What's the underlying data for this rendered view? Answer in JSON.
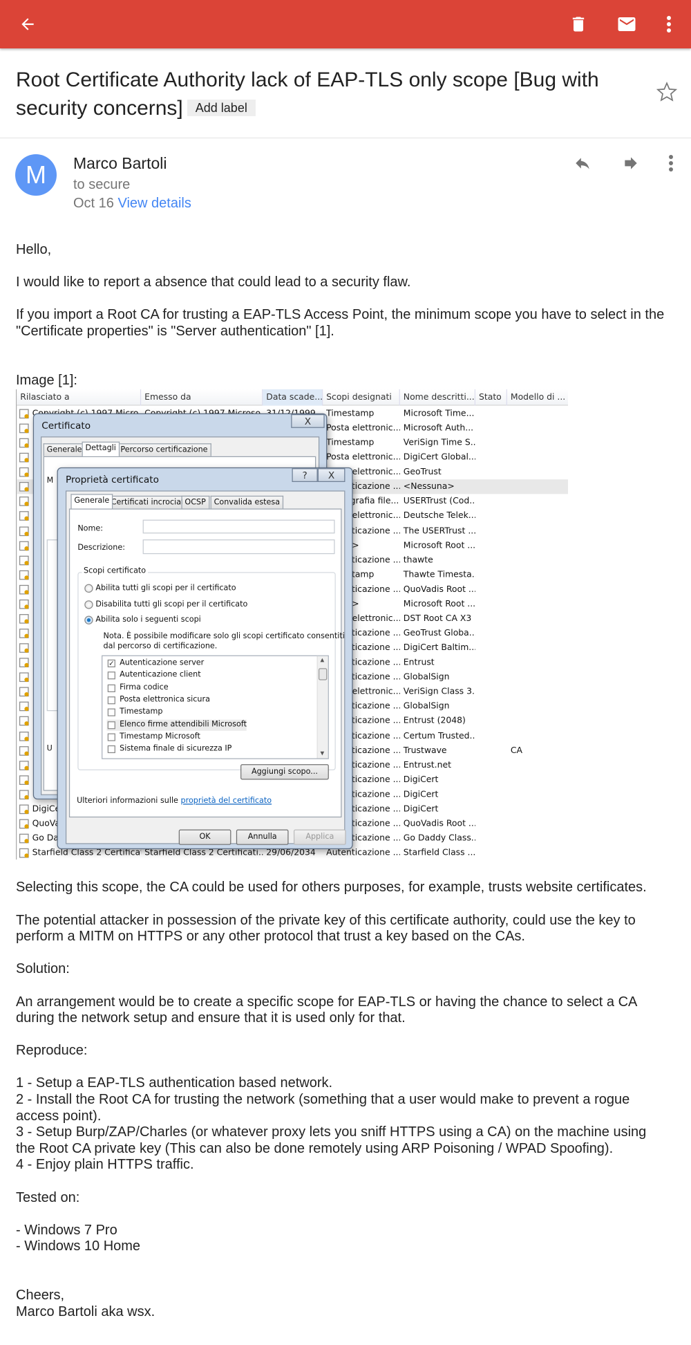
{
  "appbar": {
    "back": "arrow-back",
    "delete": "trash",
    "mark_unread": "mail",
    "more": "more-vert"
  },
  "subject": "Root Certificate Authority lack of EAP-TLS only scope [Bug with security concerns]",
  "subject_lines": [
    "Root Certificate Authority lack of EAP-TLS only scope [Bug with",
    "security concerns]"
  ],
  "add_label": "Add label",
  "sender": {
    "initial": "M",
    "name": "Marco Bartoli",
    "to": "to secure",
    "date": "Oct 16",
    "view_details": "View details"
  },
  "colors": {
    "appbar": "#db4437",
    "avatar": "#5e97f6",
    "link": "#4285f4"
  },
  "body": {
    "hello": "Hello,",
    "p1": "I would like to report a absence that could lead to a security flaw.",
    "p2": [
      "If you import a Root CA for trusting a EAP-TLS Access Point, the minimum scope you have to select in the",
      "\"Certificate properties\" is \"Server authentication\" [1]."
    ],
    "image_caption": "Image [1]:",
    "p3": "Selecting this scope, the CA could be used for others purposes, for example, trusts website certificates.",
    "p4": [
      "The potential attacker in possession of the private key of this certificate authority, could use the key to",
      "perform a MITM on HTTPS or any other protocol that trust a key based on the CAs."
    ],
    "solution": "Solution:",
    "p5": [
      "An arrangement would be to create a specific scope for EAP-TLS or having the chance to select a CA",
      "during the network setup and ensure that it is used only for that."
    ],
    "reproduce": "Reproduce:",
    "steps": [
      "1 - Setup a EAP-TLS authentication based network.",
      "2 - Install the Root CA for trusting the network (something that a user would make to prevent a rogue",
      "access point).",
      "3 - Setup Burp/ZAP/Charles (or whatever proxy lets you sniff HTTPS using a CA) on the machine using",
      "the Root CA private key (This can also be done remotely using ARP Poisoning / WPAD Spoofing).",
      "4 - Enjoy plain HTTPS traffic."
    ],
    "tested": "Tested on:",
    "platforms": [
      "- Windows 7 Pro",
      "- Windows 10 Home"
    ],
    "cheers": "Cheers,",
    "signature": "Marco Bartoli aka wsx."
  },
  "screenshot": {
    "columns": [
      "Rilasciato a",
      "Emesso da",
      "Data scade...",
      "Scopi designati",
      "Nome descritti...",
      "Stato",
      "Modello di ..."
    ],
    "rows": [
      [
        "Copyright (c) 1997 Micro...",
        "Copyright (c) 1997 Microso...",
        "31/12/1999",
        "Timestamp",
        "Microsoft Time...",
        "",
        ""
      ],
      [
        "",
        "",
        "",
        "Posta elettronic...",
        "Microsoft Auth...",
        "",
        ""
      ],
      [
        "",
        "",
        "",
        "Timestamp",
        "VeriSign Time S...",
        "",
        ""
      ],
      [
        "",
        "",
        "",
        "Posta elettronic...",
        "DigiCert Global...",
        "",
        ""
      ],
      [
        "",
        "",
        "",
        "Posta elettronic...",
        "GeoTrust",
        "",
        ""
      ],
      [
        "",
        "",
        "",
        "Autenticazione ...",
        "<Nessuna>",
        "",
        ""
      ],
      [
        "",
        "",
        "",
        "Crittografia file...",
        "USERTrust (Cod...",
        "",
        ""
      ],
      [
        "",
        "",
        "",
        "Posta elettronic...",
        "Deutsche Telek...",
        "",
        ""
      ],
      [
        "",
        "",
        "",
        "Autenticazione ...",
        "The USERTrust ...",
        "",
        ""
      ],
      [
        "",
        "",
        "",
        "<Tutti>",
        "Microsoft Root ...",
        "",
        ""
      ],
      [
        "",
        "",
        "",
        "Autenticazione ...",
        "thawte",
        "",
        ""
      ],
      [
        "",
        "",
        "",
        "Timestamp",
        "Thawte Timesta...",
        "",
        ""
      ],
      [
        "",
        "",
        "",
        "Autenticazione ...",
        "QuoVadis Root ...",
        "",
        ""
      ],
      [
        "",
        "",
        "",
        "<Tutti>",
        "Microsoft Root ...",
        "",
        ""
      ],
      [
        "",
        "",
        "",
        "Posta elettronic...",
        "DST Root CA X3",
        "",
        ""
      ],
      [
        "",
        "",
        "",
        "Autenticazione ...",
        "GeoTrust Globa...",
        "",
        ""
      ],
      [
        "",
        "",
        "",
        "Autenticazione ...",
        "DigiCert Baltim...",
        "",
        ""
      ],
      [
        "",
        "",
        "",
        "Autenticazione ...",
        "Entrust",
        "",
        ""
      ],
      [
        "",
        "",
        "",
        "Autenticazione ...",
        "GlobalSign",
        "",
        ""
      ],
      [
        "",
        "",
        "",
        "Posta elettronic...",
        "VeriSign Class 3...",
        "",
        ""
      ],
      [
        "",
        "",
        "",
        "Autenticazione ...",
        "GlobalSign",
        "",
        ""
      ],
      [
        "",
        "",
        "",
        "Autenticazione ...",
        "Entrust (2048)",
        "",
        ""
      ],
      [
        "",
        "",
        "",
        "Autenticazione ...",
        "Certum Trusted...",
        "",
        ""
      ],
      [
        "",
        "",
        "",
        "Autenticazione ...",
        "Trustwave",
        "",
        "CA"
      ],
      [
        "",
        "",
        "",
        "Autenticazione ...",
        "Entrust.net",
        "",
        ""
      ],
      [
        "",
        "",
        "",
        "Autenticazione ...",
        "DigiCert",
        "",
        ""
      ],
      [
        "",
        "",
        "",
        "Autenticazione ...",
        "DigiCert",
        "",
        ""
      ],
      [
        "DigiCert",
        "",
        "",
        "Autenticazione ...",
        "DigiCert",
        "",
        ""
      ],
      [
        "QuoVadis",
        "",
        "",
        "Autenticazione ...",
        "QuoVadis Root ...",
        "",
        ""
      ],
      [
        "Go Daddy",
        "",
        "",
        "Autenticazione ...",
        "Go Daddy Class...",
        "",
        ""
      ],
      [
        "Starfield Class 2 Certificati...",
        "Starfield Class 2 Certificati...",
        "29/06/2034",
        "Autenticazione ...",
        "Starfield Class ...",
        "",
        ""
      ]
    ],
    "selected_row": 5,
    "cert_dialog": {
      "title": "Certificato",
      "close": "X",
      "tabs": [
        "Generale",
        "Dettagli",
        "Percorso certificazione"
      ],
      "active_tab": 1,
      "labels": [
        "M",
        "U"
      ]
    },
    "props_dialog": {
      "title": "Proprietà certificato",
      "help": "?",
      "close": "X",
      "tabs": [
        "Generale",
        "Certificati incrociati",
        "OCSP",
        "Convalida estesa"
      ],
      "active_tab": 0,
      "name_label": "Nome:",
      "name_value": "",
      "desc_label": "Descrizione:",
      "desc_value": "",
      "group": "Scopi certificato",
      "radios": [
        "Abilita tutti gli scopi per il certificato",
        "Disabilita tutti gli scopi per il certificato",
        "Abilita solo i seguenti scopi"
      ],
      "radio_selected": 2,
      "note": [
        "Nota. È possibile modificare solo gli scopi certificato consentiti",
        "dal percorso di certificazione."
      ],
      "purposes": [
        {
          "label": "Autenticazione server",
          "checked": true
        },
        {
          "label": "Autenticazione client",
          "checked": false
        },
        {
          "label": "Firma codice",
          "checked": false
        },
        {
          "label": "Posta elettronica sicura",
          "checked": false
        },
        {
          "label": "Timestamp",
          "checked": false
        },
        {
          "label": "Elenco firme attendibili Microsoft",
          "checked": false
        },
        {
          "label": "Timestamp Microsoft",
          "checked": false
        },
        {
          "label": "Sistema finale di sicurezza IP",
          "checked": false
        }
      ],
      "add_scope": "Aggiungi scopo...",
      "more_info": "Ulteriori informazioni sulle",
      "more_info_link": "proprietà del certificato",
      "ok": "OK",
      "cancel": "Annulla",
      "apply": "Applica"
    }
  }
}
